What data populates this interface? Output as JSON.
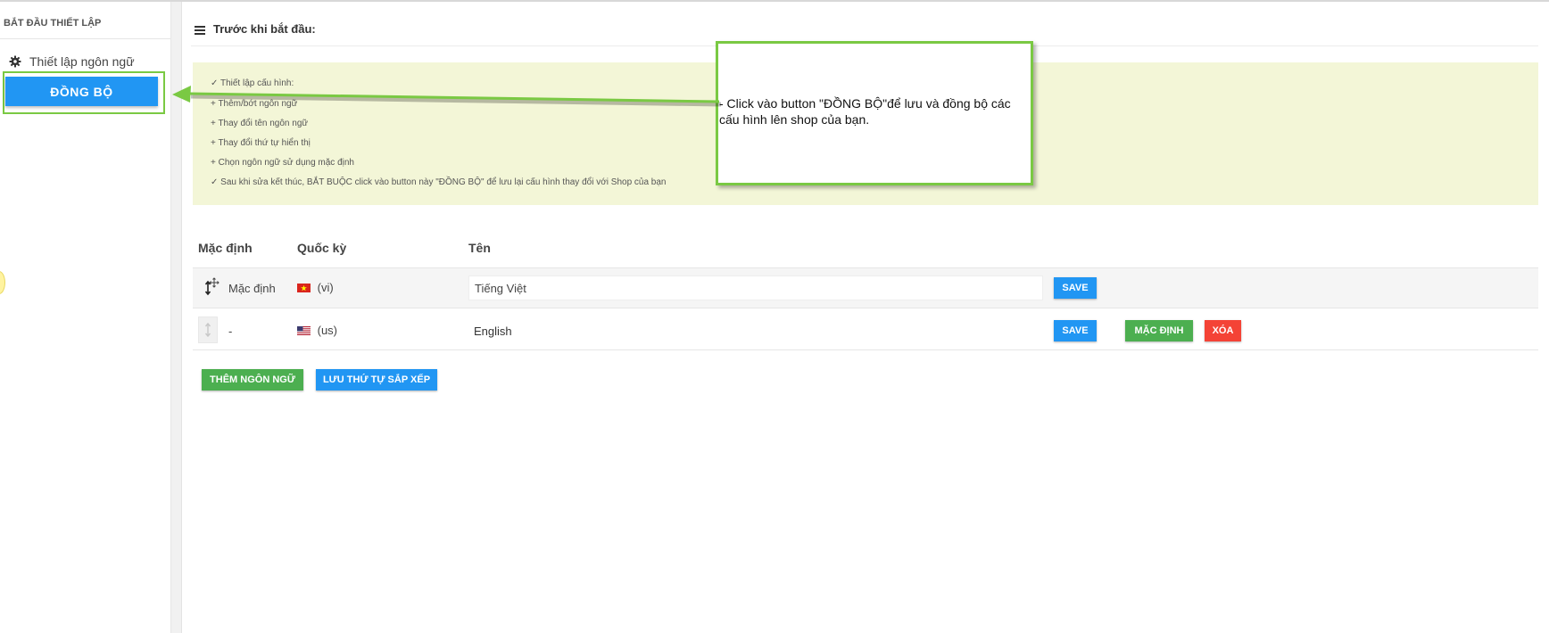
{
  "sidebar": {
    "heading": "BẮT ĐẦU THIẾT LẬP",
    "items": [
      {
        "label": "Thiết lập ngôn ngữ",
        "icon": "gear-icon"
      }
    ],
    "sync_label": "ĐỒNG BỘ"
  },
  "main": {
    "title": "Trước khi bắt đầu:",
    "title_icon": "menu-icon",
    "info_lines": [
      "✓ Thiết lập cấu hình:",
      "+ Thêm/bớt ngôn ngữ",
      "+ Thay đổi tên ngôn ngữ",
      "+ Thay đổi thứ tự hiển thị",
      "+ Chọn ngôn ngữ sử dụng mặc định",
      "✓ Sau khi sửa kết thúc, BẮT BUỘC click vào button này \"ĐỒNG BỘ\" để lưu lại cấu hình thay đổi với Shop của bạn"
    ]
  },
  "callout": {
    "text": "- Click vào button \"ĐỒNG BỘ\"để lưu và đồng bộ các cấu hình lên shop của bạn."
  },
  "table": {
    "headers": {
      "default": "Mặc định",
      "flag": "Quốc kỳ",
      "name": "Tên"
    },
    "rows": [
      {
        "default": "Mặc định",
        "code": "(vi)",
        "name": "Tiếng Việt",
        "save": "SAVE"
      },
      {
        "default": "-",
        "code": "(us)",
        "name": "English",
        "save": "SAVE",
        "set_default": "MẶC ĐỊNH",
        "delete": "XÓA"
      }
    ]
  },
  "actions": {
    "add_language": "THÊM NGÔN NGỮ",
    "save_order": "LƯU THỨ TỰ SẮP XẾP"
  },
  "colors": {
    "accent_blue": "#2196f3",
    "green": "#4caf50",
    "red": "#f44336",
    "highlight": "#7ac943",
    "info_bg": "#f3f6d7"
  }
}
